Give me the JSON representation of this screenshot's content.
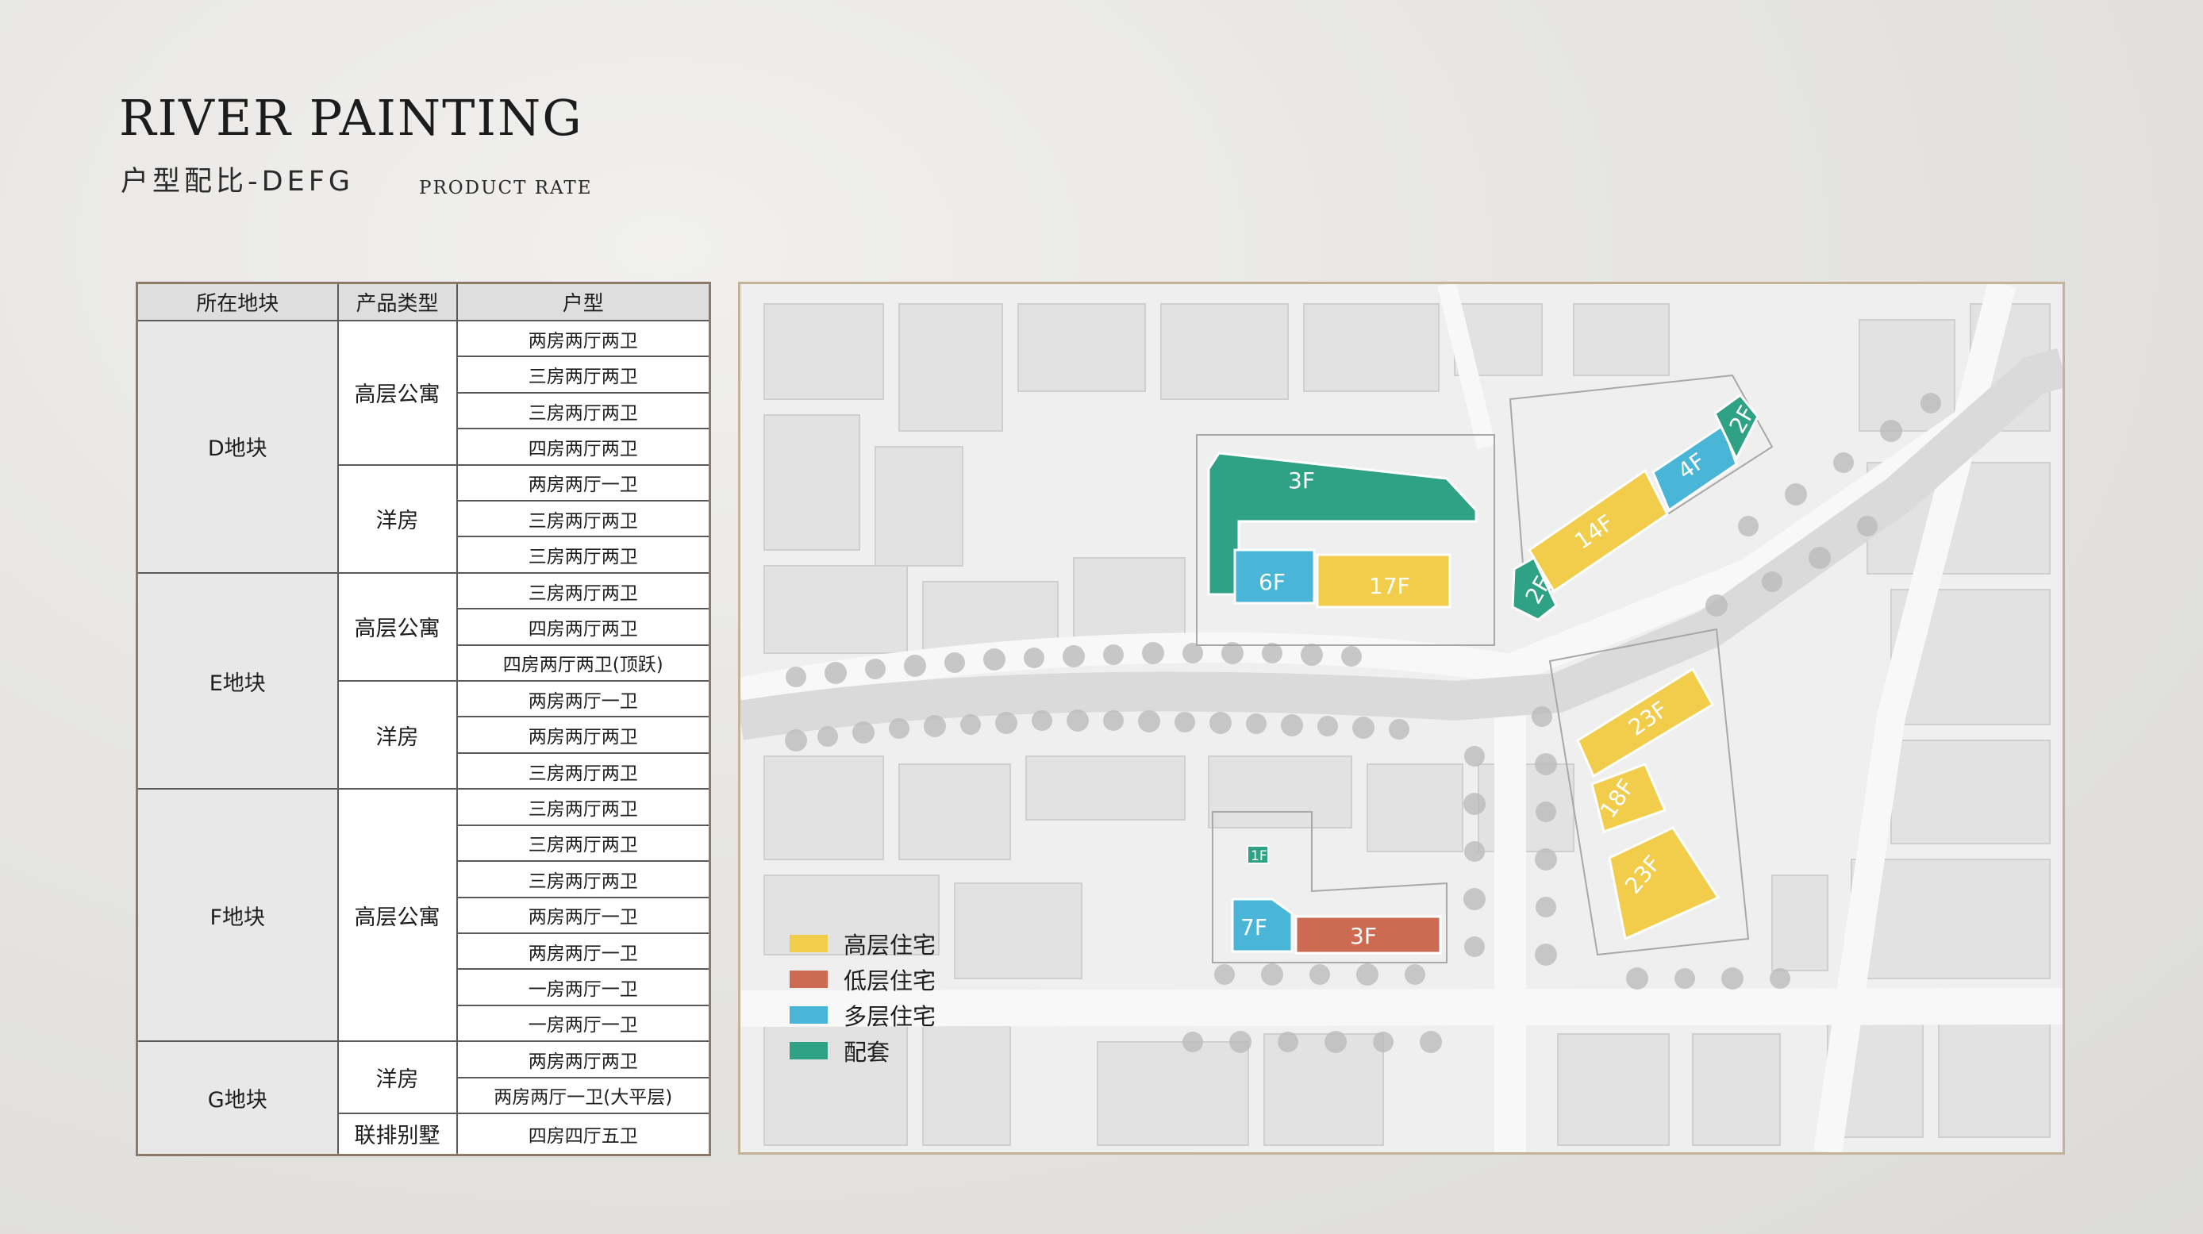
{
  "header": {
    "title": "RIVER PAINTING",
    "subtitle": "户型配比-DEFG",
    "subtitle_en": "PRODUCT RATE"
  },
  "table": {
    "headers": [
      "所在地块",
      "产品类型",
      "户型"
    ],
    "rows": [
      {
        "plot": "D地块",
        "type": "高层公寓",
        "unit": "两房两厅两卫"
      },
      {
        "unit": "三房两厅两卫"
      },
      {
        "unit": "三房两厅两卫"
      },
      {
        "unit": "四房两厅两卫"
      },
      {
        "type": "洋房",
        "unit": "两房两厅一卫"
      },
      {
        "unit": "三房两厅两卫"
      },
      {
        "unit": "三房两厅两卫"
      },
      {
        "plot": "E地块",
        "type": "高层公寓",
        "unit": "三房两厅两卫"
      },
      {
        "unit": "四房两厅两卫"
      },
      {
        "unit": "四房两厅两卫(顶跃)"
      },
      {
        "type": "洋房",
        "unit": "两房两厅一卫"
      },
      {
        "unit": "两房两厅两卫"
      },
      {
        "unit": "三房两厅两卫"
      },
      {
        "plot": "F地块",
        "type": "高层公寓",
        "unit": "三房两厅两卫"
      },
      {
        "unit": "三房两厅两卫"
      },
      {
        "unit": "三房两厅两卫"
      },
      {
        "unit": "两房两厅一卫"
      },
      {
        "unit": "两房两厅一卫"
      },
      {
        "unit": "一房两厅一卫"
      },
      {
        "unit": "一房两厅一卫"
      },
      {
        "plot": "G地块",
        "type": "洋房",
        "unit": "两房两厅两卫"
      },
      {
        "unit": "两房两厅一卫(大平层)"
      },
      {
        "type": "联排别墅",
        "unit": "四房四厅五卫"
      }
    ]
  },
  "map": {
    "buildings": [
      {
        "label": "3F",
        "category": "配套"
      },
      {
        "label": "6F",
        "category": "多层住宅"
      },
      {
        "label": "17F",
        "category": "高层住宅"
      },
      {
        "label": "2F",
        "category": "配套"
      },
      {
        "label": "4F",
        "category": "多层住宅"
      },
      {
        "label": "2F",
        "category": "配套"
      },
      {
        "label": "14F",
        "category": "高层住宅"
      },
      {
        "label": "23F",
        "category": "高层住宅"
      },
      {
        "label": "18F",
        "category": "高层住宅"
      },
      {
        "label": "23F",
        "category": "高层住宅"
      },
      {
        "label": "1F",
        "category": "配套"
      },
      {
        "label": "7F",
        "category": "多层住宅"
      },
      {
        "label": "3F",
        "category": "低层住宅"
      }
    ],
    "legend": [
      {
        "label": "高层住宅",
        "color": "#f2cd4b"
      },
      {
        "label": "低层住宅",
        "color": "#cc6a52"
      },
      {
        "label": "多层住宅",
        "color": "#49b6d8"
      },
      {
        "label": "配套",
        "color": "#2fa184"
      }
    ]
  }
}
